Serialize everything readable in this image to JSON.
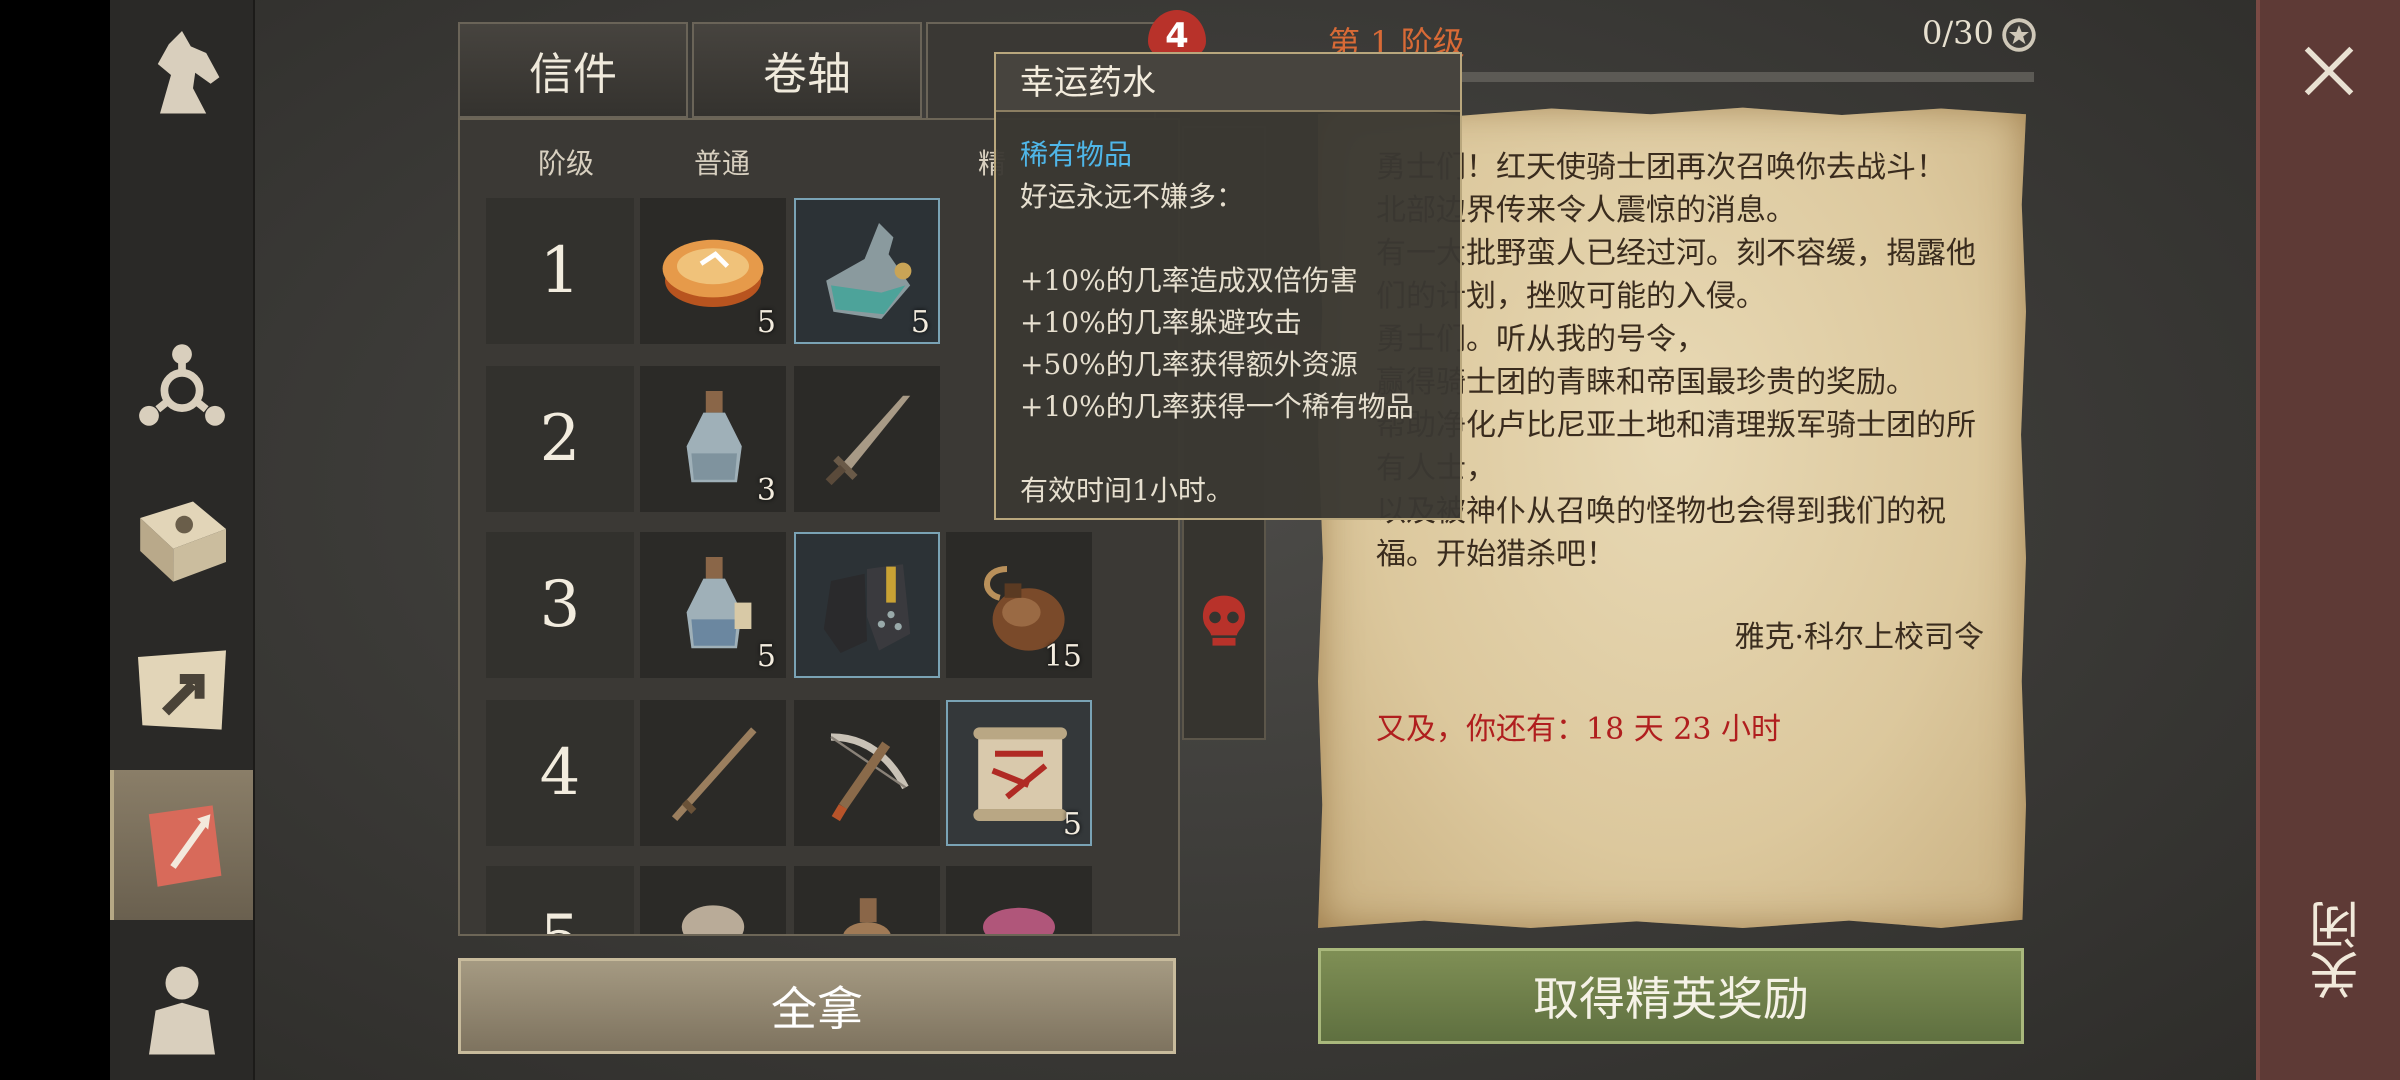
{
  "tabs": [
    {
      "label": "信件"
    },
    {
      "label": "卷轴"
    },
    {
      "label": "",
      "badge": "4"
    }
  ],
  "columns": {
    "tier": "阶级",
    "common": "普通",
    "elite": "精"
  },
  "rows": [
    {
      "tier": "1",
      "cells": [
        {
          "icon": "pie-icon",
          "qty": "5"
        },
        {
          "icon": "potion-flask-icon",
          "qty": "5"
        }
      ]
    },
    {
      "tier": "2",
      "cells": [
        {
          "icon": "potion-bottle-icon",
          "qty": "3"
        },
        {
          "icon": "sword-icon",
          "qty": ""
        }
      ]
    },
    {
      "tier": "3",
      "cells": [
        {
          "icon": "potion-bottle-icon",
          "qty": "5"
        },
        {
          "icon": "gauntlets-icon",
          "qty": ""
        },
        {
          "icon": "waterskin-icon",
          "qty": "15"
        }
      ]
    },
    {
      "tier": "4",
      "cells": [
        {
          "icon": "staff-icon",
          "qty": ""
        },
        {
          "icon": "crossbow-icon",
          "qty": ""
        },
        {
          "icon": "scroll-icon",
          "qty": "5"
        }
      ]
    },
    {
      "tier": "5",
      "cells": [
        {
          "icon": "item-icon",
          "qty": ""
        },
        {
          "icon": "item-icon",
          "qty": ""
        },
        {
          "icon": "item-icon",
          "qty": ""
        }
      ]
    }
  ],
  "buttons": {
    "take_all": "全拿",
    "elite_reward": "取得精英奖励",
    "close": "关闭"
  },
  "stage": {
    "label": "第 1 阶级",
    "progress": "0/30",
    "progress_fraction": 0
  },
  "letter": {
    "lines": [
      "勇士们！红天使骑士团再次召唤你去战斗！",
      "北部边界传来令人震惊的消息。",
      "有一大批野蛮人已经过河。刻不容缓，揭露他们的计划，挫败可能的入侵。",
      "勇士们。听从我的号令，",
      "赢得骑士团的青睐和帝国最珍贵的奖励。",
      "帮助净化卢比尼亚土地和清理叛军骑士团的所有人士，",
      "以及被神仆从召唤的怪物也会得到我们的祝福。开始猎杀吧！"
    ],
    "signature": "雅克·科尔上校司令",
    "ps": "又及，你还有：18 天 23 小时"
  },
  "tooltip": {
    "title": "幸运药水",
    "rarity": "稀有物品",
    "desc": "好运永远不嫌多：",
    "effects": [
      "+10%的几率造成双倍伤害",
      "+10%的几率躲避攻击",
      "+50%的几率获得额外资源",
      "+10%的几率获得一个稀有物品"
    ],
    "duration": "有效时间1小时。"
  },
  "colors": {
    "accent_orange": "#d86a36",
    "rare_blue": "#4fb6e8",
    "ps_red": "#b01e1e",
    "elite_green": "#6f8048"
  }
}
